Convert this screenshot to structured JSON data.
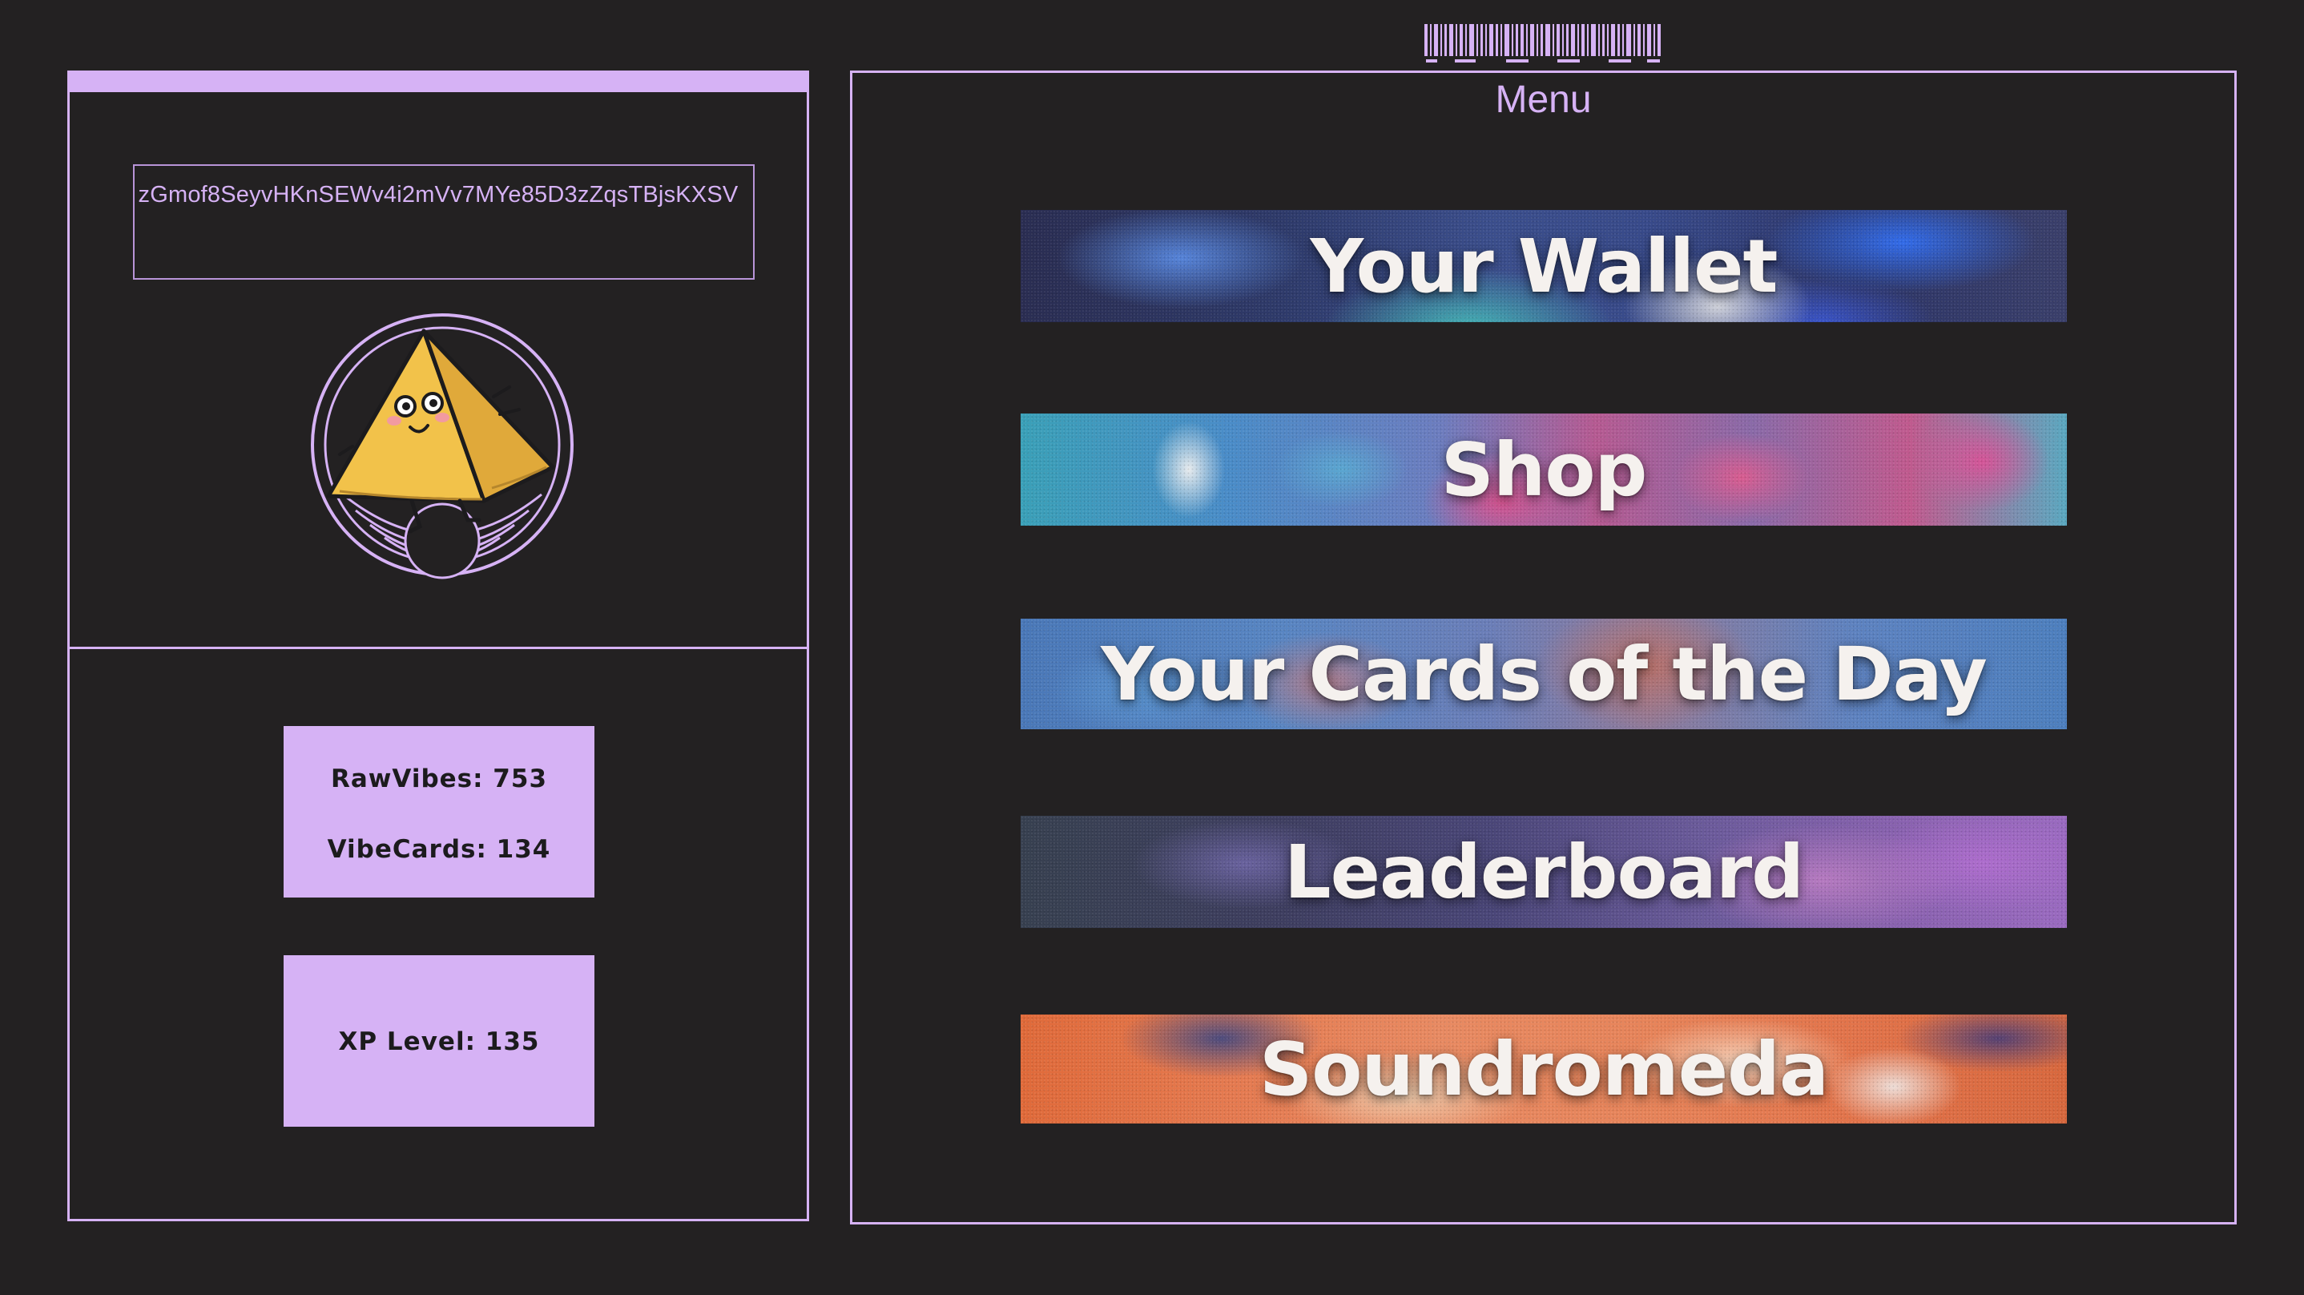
{
  "wallet": {
    "address": "zGmof8SeyvHKnSEWv4i2mVv7MYe85D3zZqsTBjsKXSV"
  },
  "stats": {
    "rawvibes": "RawVibes: 753",
    "vibecards": "VibeCards: 134",
    "xp_level": "XP Level: 135"
  },
  "menu": {
    "title": "Menu",
    "items": [
      {
        "label": "Your Wallet"
      },
      {
        "label": "Shop"
      },
      {
        "label": "Your Cards of the Day"
      },
      {
        "label": "Leaderboard"
      },
      {
        "label": "Soundromeda"
      }
    ]
  },
  "colors": {
    "background": "#232122",
    "accent": "#d6b2f5",
    "button_text": "#f5f1ee"
  },
  "icons": {
    "barcode": "barcode-icon",
    "mascot": "pyramid-mascot-icon"
  }
}
